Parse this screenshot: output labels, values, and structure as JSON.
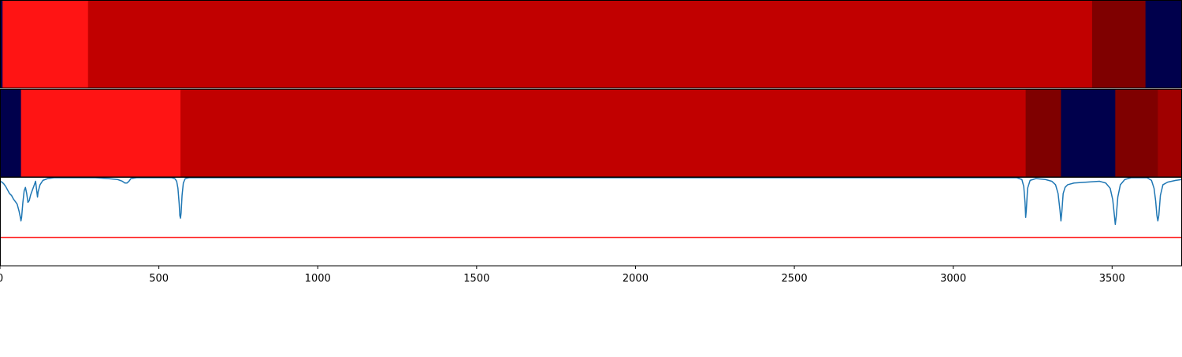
{
  "chart_data": {
    "type": "heatmap",
    "xlim": [
      0,
      3720
    ],
    "x_ticks": [
      {
        "value": 0,
        "label": "0"
      },
      {
        "value": 500,
        "label": "500"
      },
      {
        "value": 1000,
        "label": "1000"
      },
      {
        "value": 1500,
        "label": "1500"
      },
      {
        "value": 2000,
        "label": "2000"
      },
      {
        "value": 2500,
        "label": "2500"
      },
      {
        "value": 3000,
        "label": "3000"
      },
      {
        "value": 3500,
        "label": "3500"
      }
    ],
    "rows": [
      {
        "segments": [
          {
            "start": 0,
            "end": 8,
            "color": "#00004c"
          },
          {
            "start": 8,
            "end": 277,
            "color": "#ff1414"
          },
          {
            "start": 277,
            "end": 3437,
            "color": "#c10000"
          },
          {
            "start": 3437,
            "end": 3605,
            "color": "#7f0000"
          },
          {
            "start": 3605,
            "end": 3720,
            "color": "#00004c"
          }
        ]
      },
      {
        "segments": [
          {
            "start": 0,
            "end": 66,
            "color": "#00004c"
          },
          {
            "start": 66,
            "end": 568,
            "color": "#ff1414"
          },
          {
            "start": 568,
            "end": 3228,
            "color": "#c10000"
          },
          {
            "start": 3228,
            "end": 3339,
            "color": "#7f0000"
          },
          {
            "start": 3339,
            "end": 3510,
            "color": "#00004c"
          },
          {
            "start": 3510,
            "end": 3644,
            "color": "#7f0000"
          },
          {
            "start": 3644,
            "end": 3720,
            "color": "#a00000"
          }
        ]
      }
    ],
    "line_panel": {
      "ylim": [
        0,
        1
      ],
      "line_color": "#1f77b4",
      "threshold": 0.32,
      "threshold_color": "#ff0000",
      "points": [
        [
          0,
          0.96
        ],
        [
          6,
          0.95
        ],
        [
          12,
          0.93
        ],
        [
          18,
          0.9
        ],
        [
          24,
          0.86
        ],
        [
          30,
          0.82
        ],
        [
          36,
          0.8
        ],
        [
          42,
          0.76
        ],
        [
          48,
          0.73
        ],
        [
          54,
          0.7
        ],
        [
          60,
          0.62
        ],
        [
          64,
          0.55
        ],
        [
          66,
          0.51
        ],
        [
          68,
          0.55
        ],
        [
          72,
          0.72
        ],
        [
          76,
          0.85
        ],
        [
          80,
          0.89
        ],
        [
          84,
          0.82
        ],
        [
          88,
          0.72
        ],
        [
          92,
          0.74
        ],
        [
          96,
          0.8
        ],
        [
          102,
          0.86
        ],
        [
          108,
          0.92
        ],
        [
          112,
          0.96
        ],
        [
          116,
          0.84
        ],
        [
          118,
          0.78
        ],
        [
          120,
          0.84
        ],
        [
          126,
          0.92
        ],
        [
          135,
          0.97
        ],
        [
          150,
          0.99
        ],
        [
          170,
          1.0
        ],
        [
          210,
          1.0
        ],
        [
          230,
          1.0
        ],
        [
          300,
          1.0
        ],
        [
          340,
          0.99
        ],
        [
          370,
          0.98
        ],
        [
          385,
          0.96
        ],
        [
          393,
          0.94
        ],
        [
          400,
          0.94
        ],
        [
          406,
          0.96
        ],
        [
          412,
          0.99
        ],
        [
          430,
          1.0
        ],
        [
          540,
          1.0
        ],
        [
          550,
          0.99
        ],
        [
          556,
          0.96
        ],
        [
          560,
          0.88
        ],
        [
          564,
          0.7
        ],
        [
          566,
          0.57
        ],
        [
          568,
          0.54
        ],
        [
          570,
          0.6
        ],
        [
          573,
          0.8
        ],
        [
          577,
          0.94
        ],
        [
          583,
          0.99
        ],
        [
          595,
          1.0
        ],
        [
          3200,
          1.0
        ],
        [
          3216,
          0.98
        ],
        [
          3222,
          0.9
        ],
        [
          3226,
          0.72
        ],
        [
          3228,
          0.55
        ],
        [
          3230,
          0.63
        ],
        [
          3234,
          0.88
        ],
        [
          3242,
          0.97
        ],
        [
          3260,
          0.99
        ],
        [
          3290,
          0.98
        ],
        [
          3310,
          0.96
        ],
        [
          3322,
          0.92
        ],
        [
          3330,
          0.82
        ],
        [
          3336,
          0.63
        ],
        [
          3339,
          0.51
        ],
        [
          3342,
          0.62
        ],
        [
          3346,
          0.82
        ],
        [
          3352,
          0.89
        ],
        [
          3360,
          0.92
        ],
        [
          3380,
          0.94
        ],
        [
          3420,
          0.95
        ],
        [
          3460,
          0.96
        ],
        [
          3480,
          0.94
        ],
        [
          3494,
          0.88
        ],
        [
          3502,
          0.75
        ],
        [
          3507,
          0.58
        ],
        [
          3510,
          0.47
        ],
        [
          3513,
          0.56
        ],
        [
          3518,
          0.78
        ],
        [
          3526,
          0.92
        ],
        [
          3540,
          0.98
        ],
        [
          3560,
          1.0
        ],
        [
          3610,
          1.0
        ],
        [
          3624,
          0.97
        ],
        [
          3632,
          0.88
        ],
        [
          3637,
          0.74
        ],
        [
          3641,
          0.57
        ],
        [
          3644,
          0.51
        ],
        [
          3647,
          0.57
        ],
        [
          3652,
          0.8
        ],
        [
          3660,
          0.92
        ],
        [
          3675,
          0.95
        ],
        [
          3700,
          0.97
        ],
        [
          3720,
          0.98
        ]
      ]
    }
  }
}
